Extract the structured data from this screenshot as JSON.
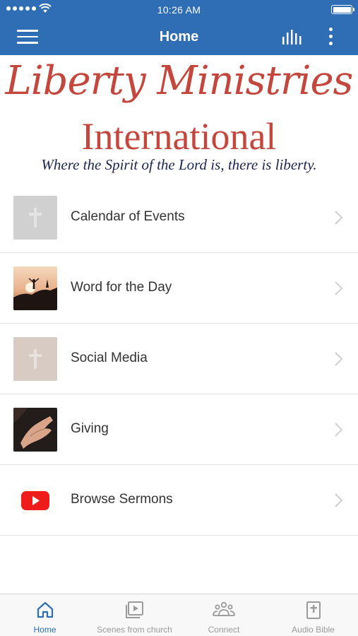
{
  "status_bar": {
    "time": "10:26 AM",
    "icons": [
      "signal-dots-icon",
      "wifi-icon",
      "battery-icon"
    ]
  },
  "nav_bar": {
    "title": "Home",
    "icons": [
      "hamburger-menu-icon",
      "audio-bars-icon",
      "more-vertical-icon"
    ],
    "background": "#2f6db5"
  },
  "banner": {
    "line1": "Liberty Ministries",
    "line2": "International",
    "line3": "Where the Spirit of the Lord is, there is liberty.",
    "primary_color": "#c4473d",
    "tagline_color": "#1c2450"
  },
  "list": {
    "items": [
      {
        "label": "Calendar of Events",
        "icon": "cross-icon"
      },
      {
        "label": "Word for the Day",
        "icon": "sunset-photo-icon"
      },
      {
        "label": "Social Media",
        "icon": "cross-icon"
      },
      {
        "label": "Giving",
        "icon": "open-hand-photo-icon"
      },
      {
        "label": "Browse Sermons",
        "icon": "youtube-icon"
      }
    ]
  },
  "tab_bar": {
    "tabs": [
      {
        "label": "Home",
        "icon": "home-icon",
        "active": true
      },
      {
        "label": "Scenes from church",
        "icon": "video-library-icon",
        "active": false
      },
      {
        "label": "Connect",
        "icon": "group-icon",
        "active": false
      },
      {
        "label": "Audio Bible",
        "icon": "bible-icon",
        "active": false
      }
    ],
    "active_color": "#2f6db5",
    "inactive_color": "#9a9a9a"
  }
}
